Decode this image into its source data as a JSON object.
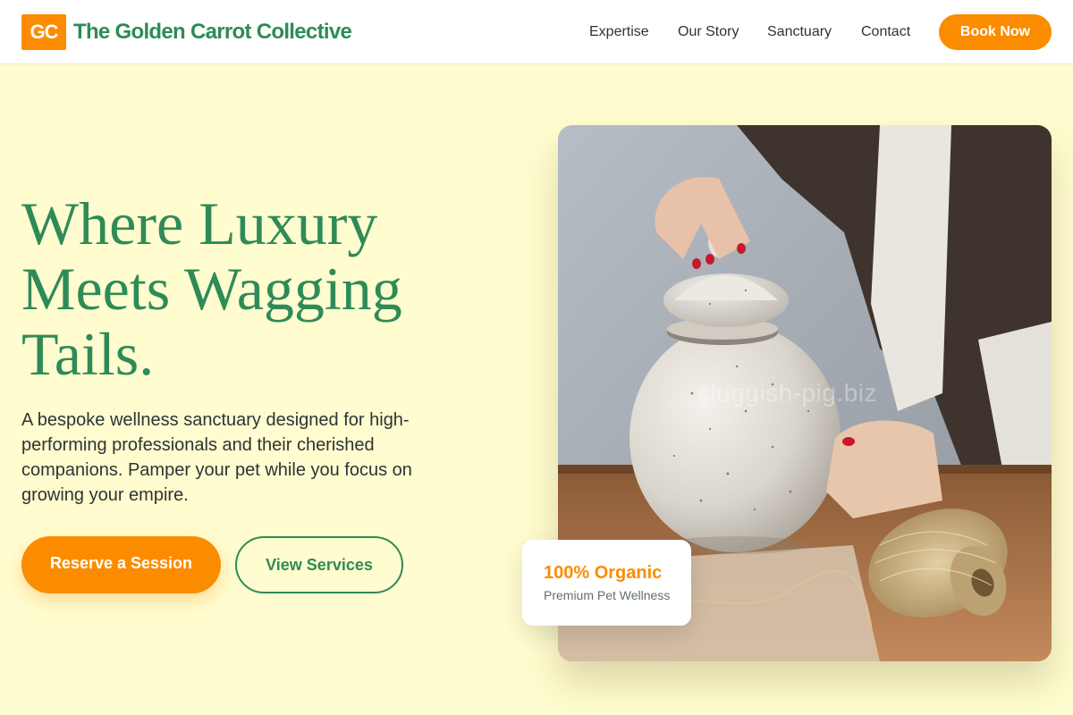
{
  "header": {
    "logo_text": "GC",
    "brand_name": "The Golden Carrot Collective",
    "nav": [
      {
        "label": "Expertise"
      },
      {
        "label": "Our Story"
      },
      {
        "label": "Sanctuary"
      },
      {
        "label": "Contact"
      }
    ],
    "cta_label": "Book Now"
  },
  "hero": {
    "title_lines": [
      "Where Luxury",
      "Meets Wagging",
      "Tails."
    ],
    "description": "A bespoke wellness sanctuary designed for high-performing professionals and their cherished companions. Pamper your pet while you focus on growing your empire.",
    "primary_cta": "Reserve a Session",
    "secondary_cta": "View Services",
    "image": {
      "subject": "hands-lifting-lid-of-speckled-ceramic-jar-with-twine-spool",
      "watermark": "sluggish-pig.biz"
    }
  },
  "badge_card": {
    "title": "100% Organic",
    "subtitle": "Premium Pet Wellness"
  },
  "colors": {
    "brand_green": "#2E8B57",
    "accent_orange": "#FB8C00",
    "background_cream": "#FFFCCF",
    "text_dark": "#2D3436"
  }
}
